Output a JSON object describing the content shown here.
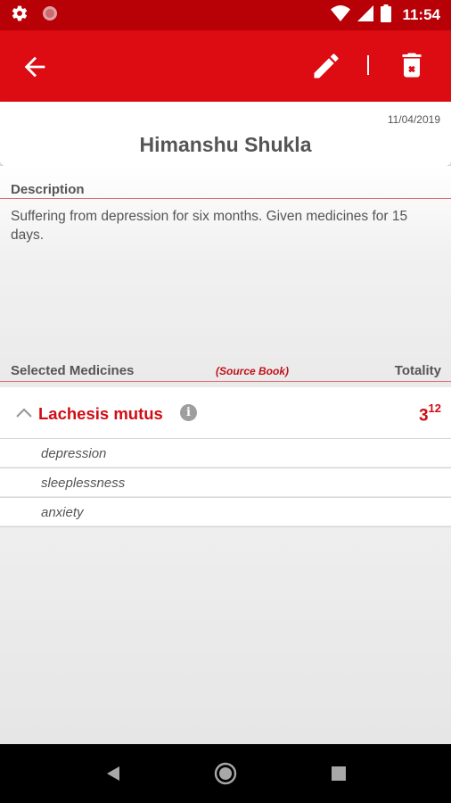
{
  "status_bar": {
    "time": "11:54",
    "icons": [
      "settings-icon",
      "notification-dot-icon",
      "wifi-icon",
      "signal-icon",
      "battery-icon"
    ]
  },
  "app_bar": {
    "icons": [
      "arrow-left-icon",
      "pencil-icon",
      "trash-icon"
    ],
    "accent_color": "#dd0b12"
  },
  "patient": {
    "date": "11/04/2019",
    "name": "Himanshu Shukla"
  },
  "description": {
    "label": "Description",
    "text": "Suffering from depression for six months. Given medicines for 15 days."
  },
  "medicines_header": {
    "selected_label": "Selected Medicines",
    "source_label": "(Source Book)",
    "totality_label": "Totality"
  },
  "medicines": [
    {
      "name": "Lachesis mutus",
      "totality_base": "3",
      "totality_sup": "12",
      "info_glyph": "i",
      "symptoms": [
        "depression",
        "sleeplessness",
        "anxiety"
      ]
    }
  ],
  "nav_bar": {
    "icons": [
      "nav-back-icon",
      "nav-home-icon",
      "nav-recents-icon"
    ]
  }
}
